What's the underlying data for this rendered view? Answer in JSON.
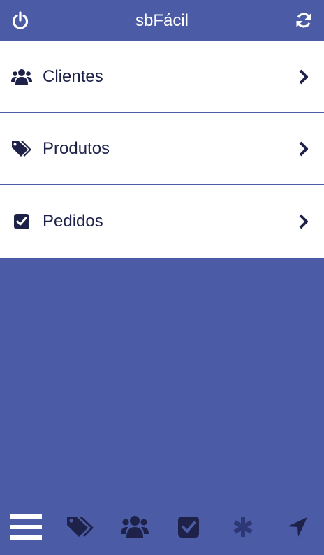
{
  "header": {
    "title": "sbFácil",
    "left_icon": "power-icon",
    "right_icon": "refresh-icon"
  },
  "menu": {
    "items": [
      {
        "label": "Clientes",
        "icon": "users-icon"
      },
      {
        "label": "Produtos",
        "icon": "tags-icon"
      },
      {
        "label": "Pedidos",
        "icon": "checkbox-icon"
      }
    ]
  },
  "bottom_bar": {
    "items": [
      {
        "icon": "menu-icon"
      },
      {
        "icon": "tags-icon"
      },
      {
        "icon": "users-icon"
      },
      {
        "icon": "checkbox-icon"
      },
      {
        "icon": "asterisk-icon"
      },
      {
        "icon": "location-arrow-icon"
      }
    ]
  },
  "colors": {
    "primary": "#4b5ba6",
    "dark": "#1e2248",
    "white": "#ffffff",
    "muted": "#2e3775"
  }
}
